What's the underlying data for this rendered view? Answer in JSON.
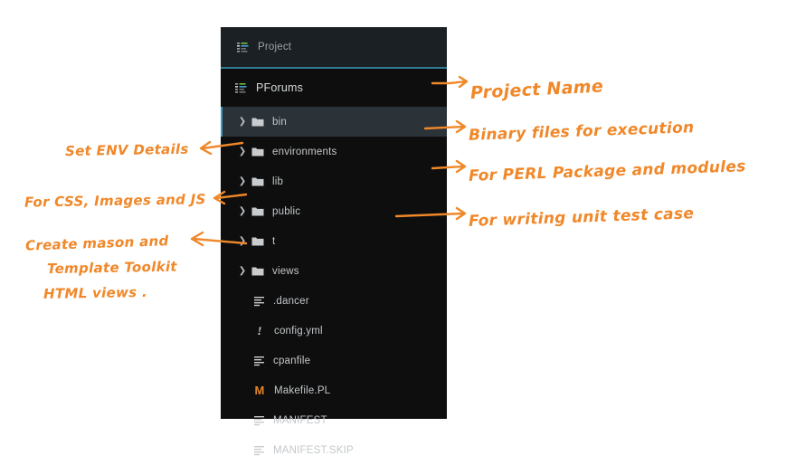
{
  "panel": {
    "header": {
      "icon": "project-tree-icon",
      "label": "Project"
    },
    "root": {
      "icon": "project-tree-icon",
      "label": "PForums"
    },
    "items": [
      {
        "label": "bin",
        "type": "folder",
        "icon": "folder-icon",
        "expandable": true,
        "selected": true
      },
      {
        "label": "environments",
        "type": "folder",
        "icon": "folder-icon",
        "expandable": true,
        "selected": false
      },
      {
        "label": "lib",
        "type": "folder",
        "icon": "folder-icon",
        "expandable": true,
        "selected": false
      },
      {
        "label": "public",
        "type": "folder",
        "icon": "folder-icon",
        "expandable": true,
        "selected": false
      },
      {
        "label": "t",
        "type": "folder",
        "icon": "folder-icon",
        "expandable": true,
        "selected": false
      },
      {
        "label": "views",
        "type": "folder",
        "icon": "folder-icon",
        "expandable": true,
        "selected": false
      },
      {
        "label": ".dancer",
        "type": "file",
        "icon": "text-file-icon",
        "expandable": false,
        "selected": false
      },
      {
        "label": "config.yml",
        "type": "file",
        "icon": "exclamation-file-icon",
        "expandable": false,
        "selected": false
      },
      {
        "label": "cpanfile",
        "type": "file",
        "icon": "text-file-icon",
        "expandable": false,
        "selected": false
      },
      {
        "label": "Makefile.PL",
        "type": "file",
        "icon": "makefile-icon",
        "expandable": false,
        "selected": false
      },
      {
        "label": "MANIFEST",
        "type": "file",
        "icon": "text-file-icon",
        "expandable": false,
        "selected": false
      },
      {
        "label": "MANIFEST.SKIP",
        "type": "file",
        "icon": "text-file-icon",
        "expandable": false,
        "selected": false
      }
    ]
  },
  "annotations": {
    "right": [
      {
        "id": "project-name",
        "text": "Project Name"
      },
      {
        "id": "bin-note",
        "text": "Binary files for execution"
      },
      {
        "id": "lib-note",
        "text": "For PERL Package and modules"
      },
      {
        "id": "t-note",
        "text": "For writing unit test case"
      }
    ],
    "left": [
      {
        "id": "environments-note",
        "text": "Set ENV Details"
      },
      {
        "id": "public-note",
        "text": "For CSS, Images and JS"
      },
      {
        "id": "views-note-l1",
        "text": "Create mason and"
      },
      {
        "id": "views-note-l2",
        "text": "Template Toolkit"
      },
      {
        "id": "views-note-l3",
        "text": "HTML views ."
      }
    ]
  },
  "colors": {
    "panel_bg": "#0e0e0e",
    "header_bg": "#1b2024",
    "divider": "#2f7d94",
    "selected_bg": "#2b3238",
    "selected_marker": "#3a9ec4",
    "text": "#c3c7ca",
    "annotation": "#f0882a",
    "makefile_icon": "#e2842a"
  }
}
